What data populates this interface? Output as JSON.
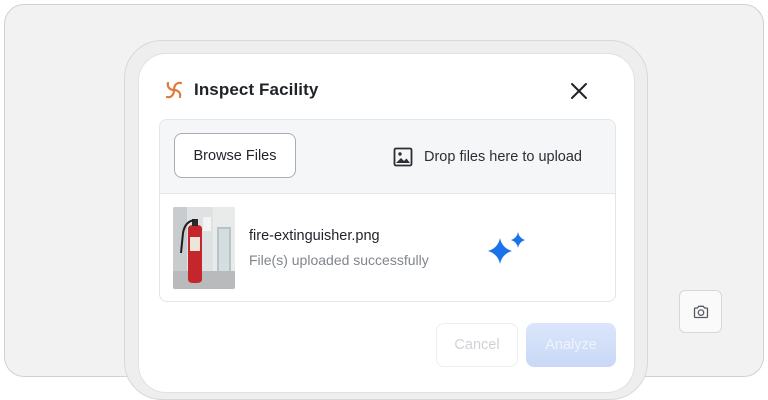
{
  "dialog": {
    "title": "Inspect Facility",
    "close_icon": "close-icon",
    "logo_icon": "swirl-logo-icon"
  },
  "upload": {
    "browse_label": "Browse Files",
    "drop_text": "Drop files here to upload",
    "drop_icon": "image-icon"
  },
  "file": {
    "name": "fire-extinguisher.png",
    "status": "File(s) uploaded successfully",
    "status_icon": "sparkle-icon"
  },
  "actions": {
    "cancel_label": "Cancel",
    "analyze_label": "Analyze"
  },
  "side": {
    "camera_icon": "camera-icon"
  },
  "colors": {
    "logo": "#e07a3a",
    "sparkle": "#1a73e8",
    "analyze_disabled": "#c8d8f6"
  }
}
